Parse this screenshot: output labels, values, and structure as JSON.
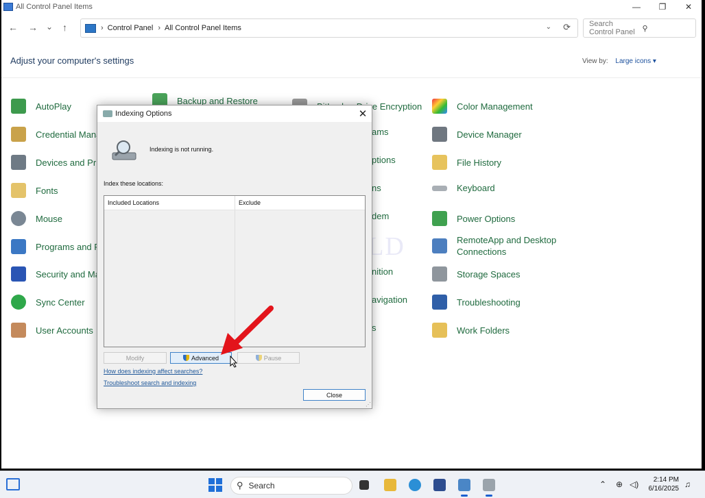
{
  "window": {
    "title": "All Control Panel Items",
    "controls": {
      "minimize": "—",
      "maximize": "❐",
      "close": "✕"
    }
  },
  "nav": {
    "back": "←",
    "forward": "→",
    "recent": "⌄",
    "up": "↑",
    "breadcrumb": [
      "Control Panel",
      "All Control Panel Items"
    ],
    "dropdown": "⌄",
    "refresh": "⟳",
    "search_placeholder": "Search Control Panel"
  },
  "header": {
    "title": "Adjust your computer's settings",
    "view_by_label": "View by:",
    "view_by_value": "Large icons ▾"
  },
  "items": [
    {
      "label": "AutoPlay"
    },
    {
      "label": "Credential Mana"
    },
    {
      "label": "Devices and Prin"
    },
    {
      "label": "Fonts"
    },
    {
      "label": "Mouse"
    },
    {
      "label": "Programs and F"
    },
    {
      "label": "Security and Ma"
    },
    {
      "label": "Sync Center"
    },
    {
      "label": "User Accounts"
    },
    {
      "label": "Backup and Restore"
    },
    {
      "label": "BitLocker Drive Encryption"
    },
    {
      "label": "ams"
    },
    {
      "label": "ptions"
    },
    {
      "label": "ns"
    },
    {
      "label": "dem"
    },
    {
      "label": "nition"
    },
    {
      "label": "avigation"
    },
    {
      "label": "s"
    },
    {
      "label": "Color Management"
    },
    {
      "label": "Device Manager"
    },
    {
      "label": "File History"
    },
    {
      "label": "Keyboard"
    },
    {
      "label": "Power Options"
    },
    {
      "label": "RemoteApp and Desktop"
    },
    {
      "label": "Connections"
    },
    {
      "label": "Storage Spaces"
    },
    {
      "label": "Troubleshooting"
    },
    {
      "label": "Work Folders"
    }
  ],
  "watermark": "IT Pros HLD",
  "dialog": {
    "title": "Indexing Options",
    "close": "✕",
    "status": "Indexing is not running.",
    "locations_label": "Index these locations:",
    "columns": [
      "Included Locations",
      "Exclude"
    ],
    "buttons": {
      "modify": "Modify",
      "advanced": "Advanced",
      "pause": "Pause",
      "close": "Close"
    },
    "links": [
      "How does indexing affect searches?",
      "Troubleshoot search and indexing"
    ]
  },
  "taskbar": {
    "search": "Search",
    "time": "2:14 PM",
    "date": "6/16/2025"
  },
  "colors": {
    "accent": "#1e5799",
    "item_text": "#1f6a3e",
    "arrow": "#e3141b"
  }
}
